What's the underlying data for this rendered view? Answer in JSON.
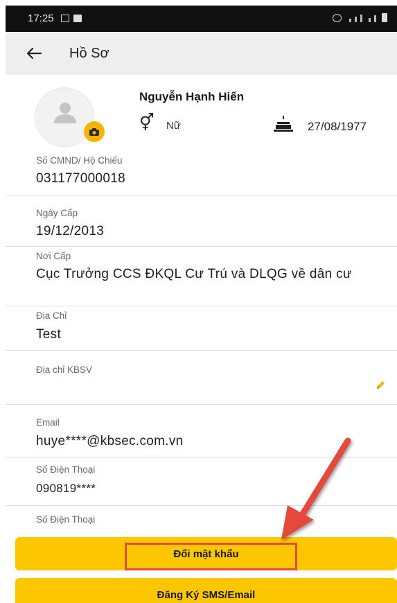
{
  "status_bar": {
    "time": "17:25"
  },
  "app_bar": {
    "title": "Hồ Sơ",
    "back_icon": "arrow-left-icon"
  },
  "profile": {
    "name": "Nguyễn Hạnh Hiến",
    "gender": "Nữ",
    "birthday": "27/08/1977",
    "icons": {
      "avatar": "person-placeholder-icon",
      "camera": "camera-icon",
      "gender": "gender-icon",
      "birthday": "cake-icon"
    }
  },
  "fields": [
    {
      "label": "Số CMND/ Hộ Chiếu",
      "value": "031177000018"
    },
    {
      "label": "Ngày Cấp",
      "value": "19/12/2013"
    },
    {
      "label": "Nơi Cấp",
      "value": "Cục Trưởng CCS ĐKQL Cư Trú và DLQG về dân cư"
    },
    {
      "label": "Địa Chỉ",
      "value": "Test"
    },
    {
      "label": "Địa chỉ KBSV",
      "value": ""
    },
    {
      "label": "Email",
      "value": "huye****@kbsec.com.vn"
    },
    {
      "label": "Số Điện Thoại",
      "value": "090819****"
    },
    {
      "label": "Số Điện Thoại",
      "value": ""
    }
  ],
  "buttons": {
    "change_password": "Đổi mật khẩu",
    "register_sms_email": "Đăng Ký SMS/Email"
  },
  "colors": {
    "accent": "#fdc700",
    "annotation": "#e5493a",
    "app_bar": "#eeeeee"
  }
}
